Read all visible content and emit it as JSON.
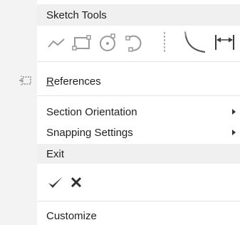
{
  "menu": {
    "sketch_tools": {
      "title": "Sketch Tools",
      "tools": [
        "polyline-icon",
        "rectangle-icon",
        "circle-icon",
        "arc-icon",
        "centerline-icon",
        "fillet-icon",
        "dimension-icon"
      ]
    },
    "references": {
      "label": "References",
      "icon": "references-icon"
    },
    "section_orientation": {
      "label": "Section Orientation",
      "has_submenu": true
    },
    "snapping_settings": {
      "label": "Snapping Settings",
      "has_submenu": true
    },
    "exit": {
      "title": "Exit",
      "actions": [
        "accept-checkmark-icon",
        "cancel-x-icon"
      ]
    },
    "customize": {
      "label": "Customize"
    }
  },
  "colors": {
    "header_bg": "#f0f0f0",
    "gutter_bg": "#f3f3f3",
    "separator": "#e2e2e2",
    "icon": "#9a9a9a",
    "icon_dark": "#3c3c3c"
  }
}
